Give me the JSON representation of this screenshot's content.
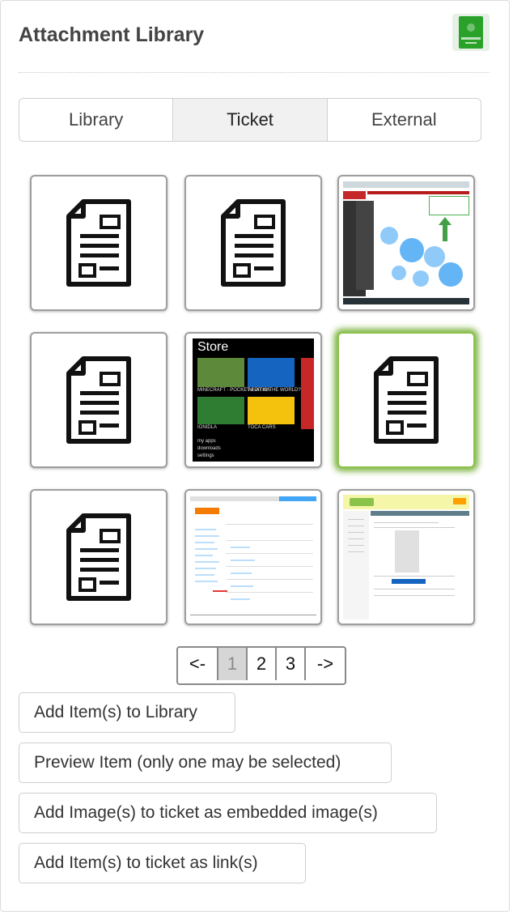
{
  "header": {
    "title": "Attachment Library",
    "app_icon": "zendesk-app-icon"
  },
  "tabs": [
    {
      "label": "Library",
      "active": false
    },
    {
      "label": "Ticket",
      "active": true
    },
    {
      "label": "External",
      "active": false
    }
  ],
  "grid": {
    "items": [
      {
        "kind": "document",
        "icon": "document-icon",
        "selected": false
      },
      {
        "kind": "document",
        "icon": "document-icon",
        "selected": false
      },
      {
        "kind": "image",
        "preview": "browser-screenshot",
        "selected": false
      },
      {
        "kind": "document",
        "icon": "document-icon",
        "selected": false
      },
      {
        "kind": "image",
        "preview": "store-screenshot",
        "selected": false
      },
      {
        "kind": "document",
        "icon": "document-icon",
        "selected": true
      },
      {
        "kind": "document",
        "icon": "document-icon",
        "selected": false
      },
      {
        "kind": "image",
        "preview": "magento-screenshot",
        "selected": false
      },
      {
        "kind": "image",
        "preview": "zendesk-screenshot",
        "selected": false
      }
    ]
  },
  "store_preview": {
    "title": "Store",
    "tile_captions": [
      "MINECRAFT - POCKET EDITION",
      "WHAT IN THE WORLD?",
      "IONIDLA",
      "TOCA CARS"
    ],
    "menu": [
      "my apps",
      "downloads",
      "settings"
    ]
  },
  "pagination": {
    "prev_label": "<-",
    "pages": [
      "1",
      "2",
      "3"
    ],
    "current_page": "1",
    "next_label": "->"
  },
  "actions": {
    "add_to_library": "Add Item(s) to Library",
    "preview_item": "Preview Item (only one may be selected)",
    "add_embedded": "Add Image(s) to ticket as embedded image(s)",
    "add_links": "Add Item(s) to ticket as link(s)"
  },
  "colors": {
    "selected_glow": "#8bc34a",
    "active_tab_bg": "#f1f1f1",
    "current_page_bg": "#d6d6d6"
  }
}
